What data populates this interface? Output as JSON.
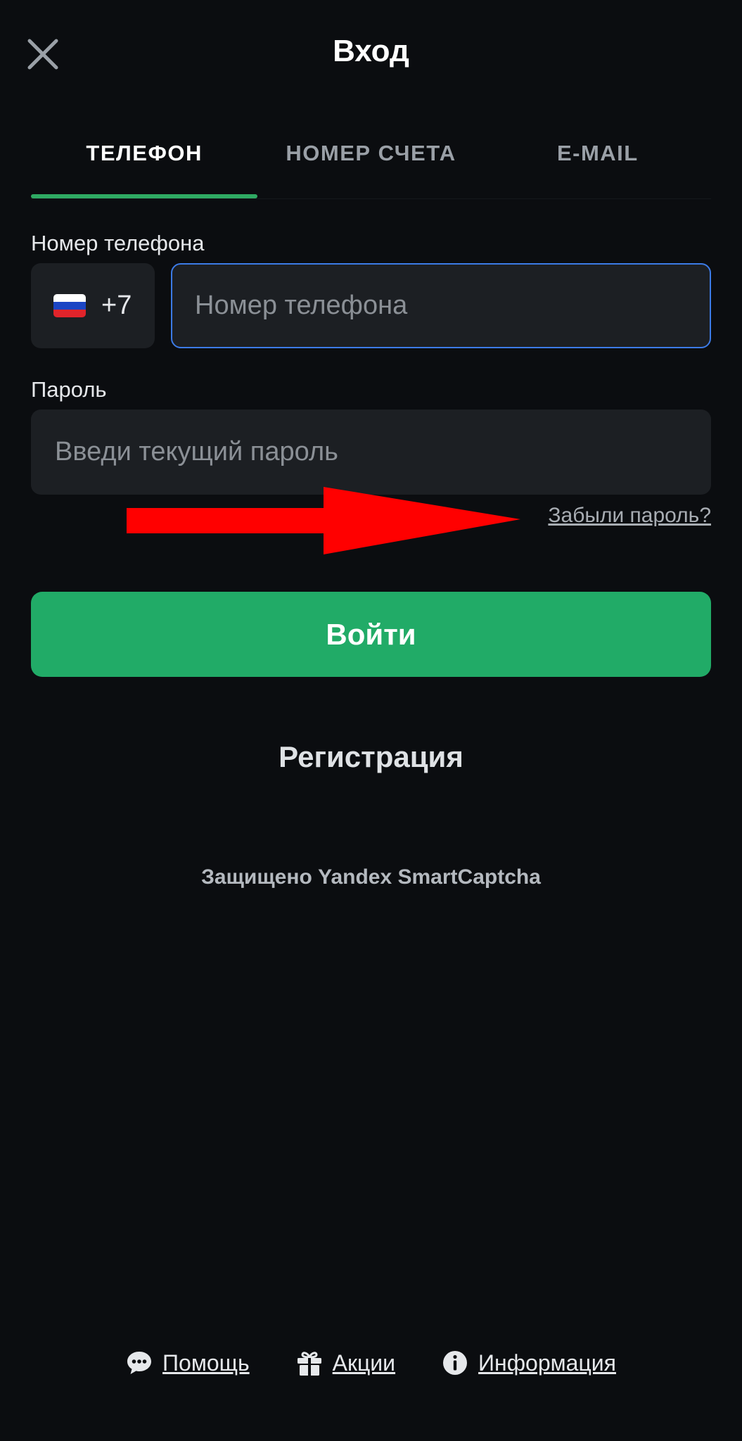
{
  "header": {
    "title": "Вход",
    "close_icon": "close-icon"
  },
  "tabs": [
    {
      "label": "ТЕЛЕФОН",
      "active": true
    },
    {
      "label": "НОМЕР СЧЕТА",
      "active": false
    },
    {
      "label": "E-MAIL",
      "active": false
    }
  ],
  "phone": {
    "label": "Номер телефона",
    "country_flag": "russia-flag-icon",
    "country_code": "+7",
    "value": "",
    "placeholder": "Номер телефона"
  },
  "password": {
    "label": "Пароль",
    "value": "",
    "placeholder": "Введи текущий пароль",
    "forgot_link": "Забыли пароль?"
  },
  "annotation": {
    "arrow_color": "#ff0000",
    "arrow_icon": "red-arrow-right"
  },
  "actions": {
    "login_label": "Войти",
    "register_label": "Регистрация"
  },
  "captcha_text": "Защищено Yandex SmartCaptcha",
  "footer": [
    {
      "label": "Помощь",
      "icon": "chat-bubble-icon"
    },
    {
      "label": "Акции",
      "icon": "gift-icon"
    },
    {
      "label": "Информация",
      "icon": "info-icon"
    }
  ],
  "colors": {
    "background": "#0b0d10",
    "accent_green": "#21ab67",
    "focus_blue": "#3c7be6",
    "field_bg": "#1c1f23"
  }
}
